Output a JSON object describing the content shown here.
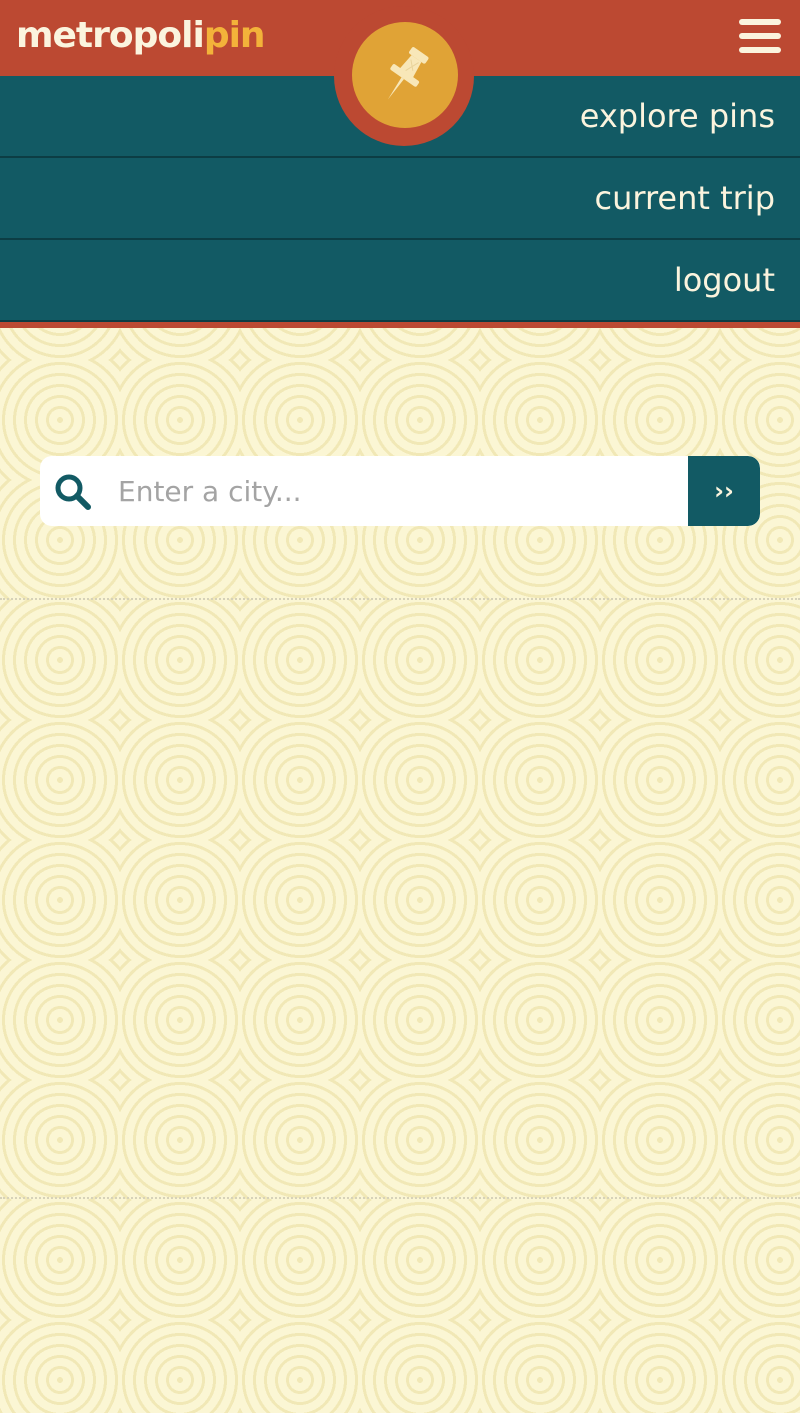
{
  "header": {
    "logo_main": "metropoli",
    "logo_accent": "pin",
    "menu_icon": "hamburger-menu-icon",
    "badge_icon": "pushpin-icon",
    "colors": {
      "bar": "#bc4932",
      "badge": "#e0a336",
      "accent_text": "#f3b23a"
    }
  },
  "nav": {
    "items": [
      {
        "label": "explore pins"
      },
      {
        "label": "current trip"
      },
      {
        "label": "logout"
      }
    ],
    "color": "#125a64"
  },
  "search": {
    "placeholder": "Enter a city...",
    "value": "",
    "icon": "search-icon",
    "submit_label": "››"
  }
}
